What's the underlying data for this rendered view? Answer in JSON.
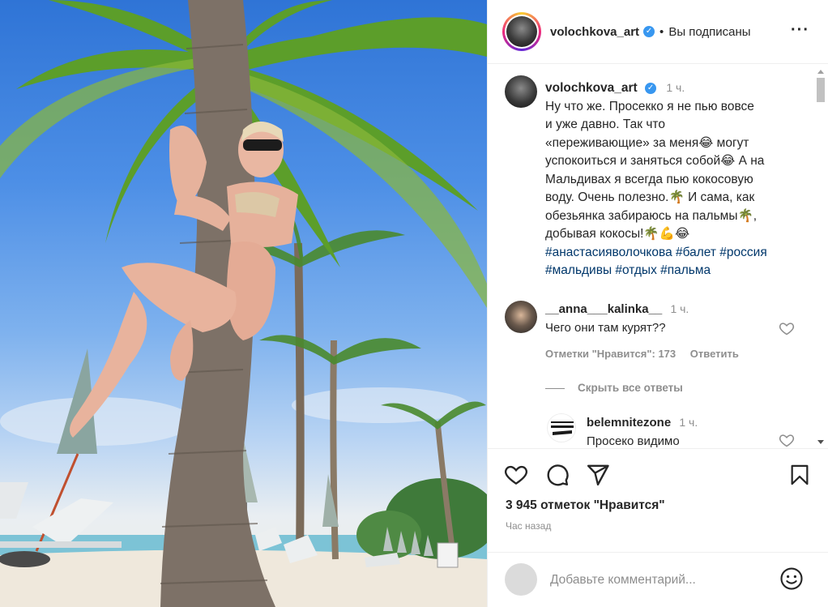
{
  "post": {
    "username": "volochkova_art",
    "verified_icon": "verified-badge-icon",
    "follow_status": "Вы подписаны",
    "more_icon": "more-options-icon",
    "caption": {
      "username": "volochkova_art",
      "time": "1 ч.",
      "lines": [
        "Ну что же. Просекко я не пью вовсе",
        "и уже давно. Так что",
        "«переживающие» за меня😂 могут",
        "успокоиться и заняться собой😂 А на",
        "Мальдивах я всегда пью кокосовую",
        "воду. Очень полезно.🌴 И сама, как",
        "обезьянка забираюсь на пальмы🌴,",
        "добывая кокосы!🌴💪😂"
      ],
      "hashtags_line1": "#анастасияволочкова #балет #россия",
      "hashtags_line2": "#мальдивы #отдых #пальма"
    },
    "comments": [
      {
        "username": "__anna___kalinka__",
        "time": "1 ч.",
        "text": "Чего они там курят??",
        "likes": "Отметки \"Нравится\": 173",
        "reply": "Ответить",
        "hide_replies": "Скрыть все ответы"
      },
      {
        "username": "belemnitezone",
        "time": "1 ч.",
        "text": "Просеко видимо"
      }
    ],
    "likes_count": "3 945 отметок \"Нравится\"",
    "posted_ago": "Час назад",
    "add_comment_placeholder": "Добавьте комментарий...",
    "colors": {
      "link": "#00376b",
      "muted": "#8e8e8e",
      "verified": "#3897f0",
      "text": "#262626"
    }
  }
}
